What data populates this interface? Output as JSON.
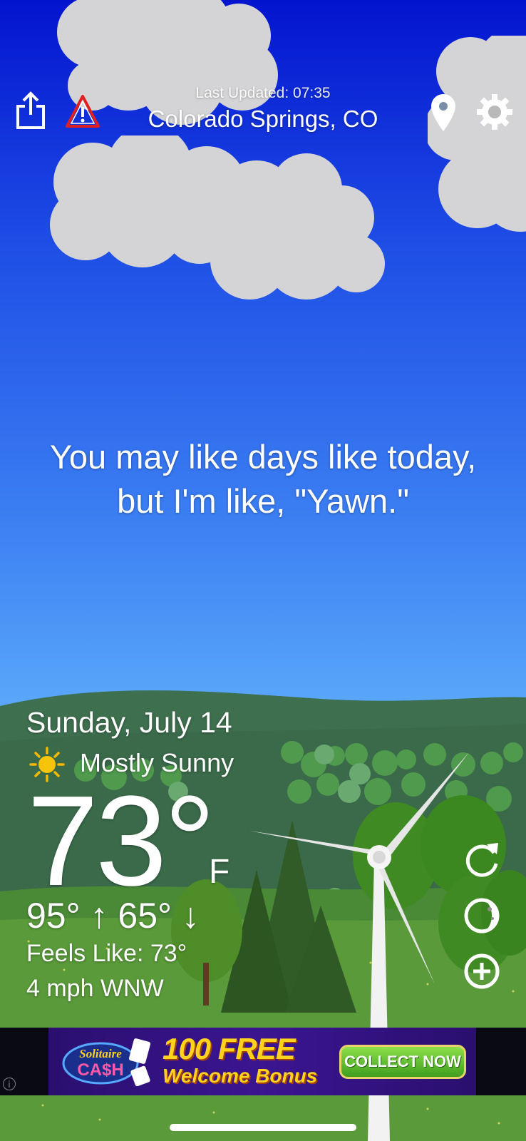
{
  "header": {
    "last_updated": "Last Updated: 07:35",
    "location": "Colorado Springs, CO",
    "icons": [
      "share-icon",
      "alert-icon",
      "location-pin-icon",
      "settings-gear-icon"
    ]
  },
  "quote": {
    "line1": "You may like days like today,",
    "line2": "but I'm like, \"Yawn.\""
  },
  "weather": {
    "date": "Sunday, July 14",
    "condition_icon": "sun-icon",
    "condition": "Mostly Sunny",
    "temperature": "73°",
    "unit": "F",
    "high_low": "95° ↑ 65° ↓",
    "feels_like": "Feels Like: 73°",
    "wind": "4 mph WNW"
  },
  "controls": [
    "refresh-icon",
    "moon-phase-icon",
    "add-icon"
  ],
  "ad": {
    "logo_line1": "Solitaire",
    "logo_line2": "CA$H",
    "headline": "100 FREE",
    "subline": "Welcome Bonus",
    "button": "COLLECT NOW"
  },
  "colors": {
    "sky_top": "#0314cf",
    "sky_bottom": "#64b0fb",
    "hill_dark": "#3b6a4c",
    "grass": "#5a9a3a",
    "alert_red": "#e02020"
  }
}
